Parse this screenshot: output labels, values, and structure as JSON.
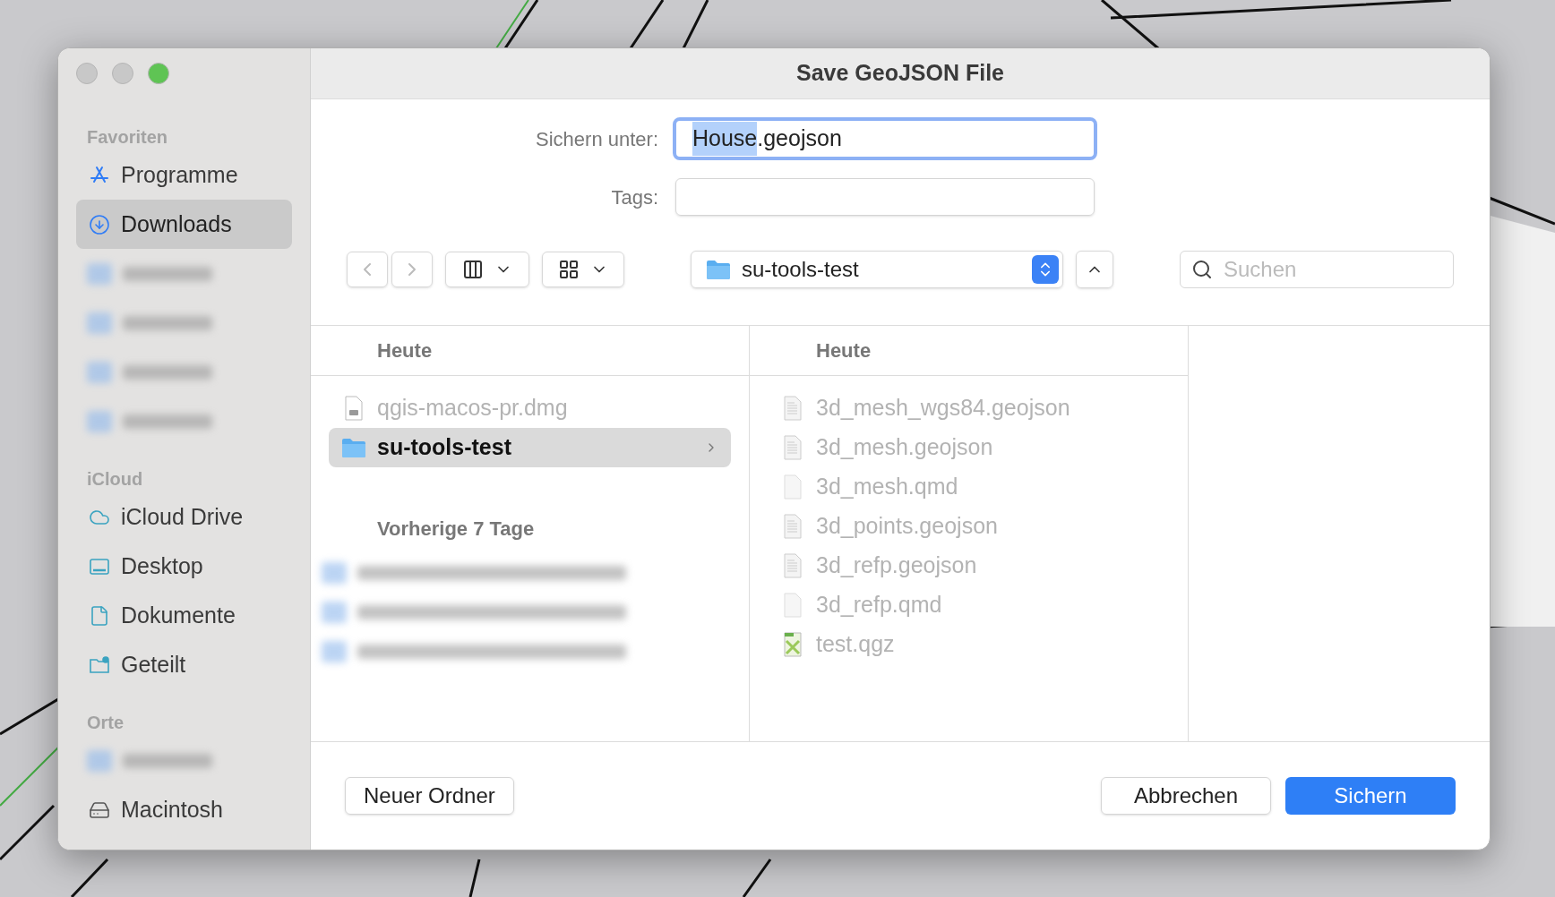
{
  "window": {
    "title": "Save GeoJSON File",
    "traffic_lights": [
      {
        "kind": "close"
      },
      {
        "kind": "minimize"
      },
      {
        "kind": "zoom"
      }
    ]
  },
  "sidebar": {
    "sections": [
      {
        "title": "Favoriten",
        "items": [
          {
            "kind": "apps",
            "label": "Programme",
            "selected": false
          },
          {
            "kind": "download",
            "label": "Downloads",
            "selected": true
          },
          {
            "kind": "blurred"
          },
          {
            "kind": "blurred"
          },
          {
            "kind": "blurred"
          },
          {
            "kind": "blurred"
          }
        ]
      },
      {
        "title": "iCloud",
        "items": [
          {
            "kind": "cloud",
            "label": "iCloud Drive",
            "selected": false
          },
          {
            "kind": "desktop",
            "label": "Desktop",
            "selected": false
          },
          {
            "kind": "document",
            "label": "Dokumente",
            "selected": false
          },
          {
            "kind": "shared",
            "label": "Geteilt",
            "selected": false
          }
        ]
      },
      {
        "title": "Orte",
        "items": [
          {
            "kind": "blurred"
          },
          {
            "kind": "disk",
            "label": "Macintosh",
            "selected": false
          }
        ]
      }
    ]
  },
  "form": {
    "save_as": {
      "label": "Sichern unter:",
      "value_parts": [
        {
          "text": "House",
          "selected": true
        },
        {
          "text": ".geojson",
          "selected": false
        }
      ]
    },
    "tags": {
      "label": "Tags:"
    }
  },
  "toolbar": {
    "location": "su-tools-test",
    "search": {
      "placeholder": "Suchen"
    }
  },
  "columns": [
    {
      "groups": [
        {
          "title": "Heute",
          "items": [
            {
              "kind": "dmg",
              "name": "qgis-macos-pr.dmg",
              "disabled": true,
              "selected": false
            },
            {
              "kind": "folder",
              "name": "su-tools-test",
              "disabled": false,
              "selected": true
            }
          ]
        },
        {
          "title": "Vorherige 7 Tage",
          "items": [
            {
              "kind": "blurred"
            },
            {
              "kind": "blurred"
            },
            {
              "kind": "blurred"
            }
          ]
        }
      ]
    },
    {
      "groups": [
        {
          "title": "Heute",
          "items": [
            {
              "kind": "geojson",
              "name": "3d_mesh_wgs84.geojson",
              "disabled": true,
              "selected": false
            },
            {
              "kind": "geojson",
              "name": "3d_mesh.geojson",
              "disabled": true,
              "selected": false
            },
            {
              "kind": "qmd",
              "name": "3d_mesh.qmd",
              "disabled": true,
              "selected": false
            },
            {
              "kind": "geojson",
              "name": "3d_points.geojson",
              "disabled": true,
              "selected": false
            },
            {
              "kind": "geojson",
              "name": "3d_refp.geojson",
              "disabled": true,
              "selected": false
            },
            {
              "kind": "qmd",
              "name": "3d_refp.qmd",
              "disabled": true,
              "selected": false
            },
            {
              "kind": "qgz",
              "name": "test.qgz",
              "disabled": true,
              "selected": false
            }
          ]
        }
      ]
    }
  ],
  "buttons": {
    "new_folder": "Neuer Ordner",
    "cancel": "Abbrechen",
    "save": "Sichern"
  }
}
